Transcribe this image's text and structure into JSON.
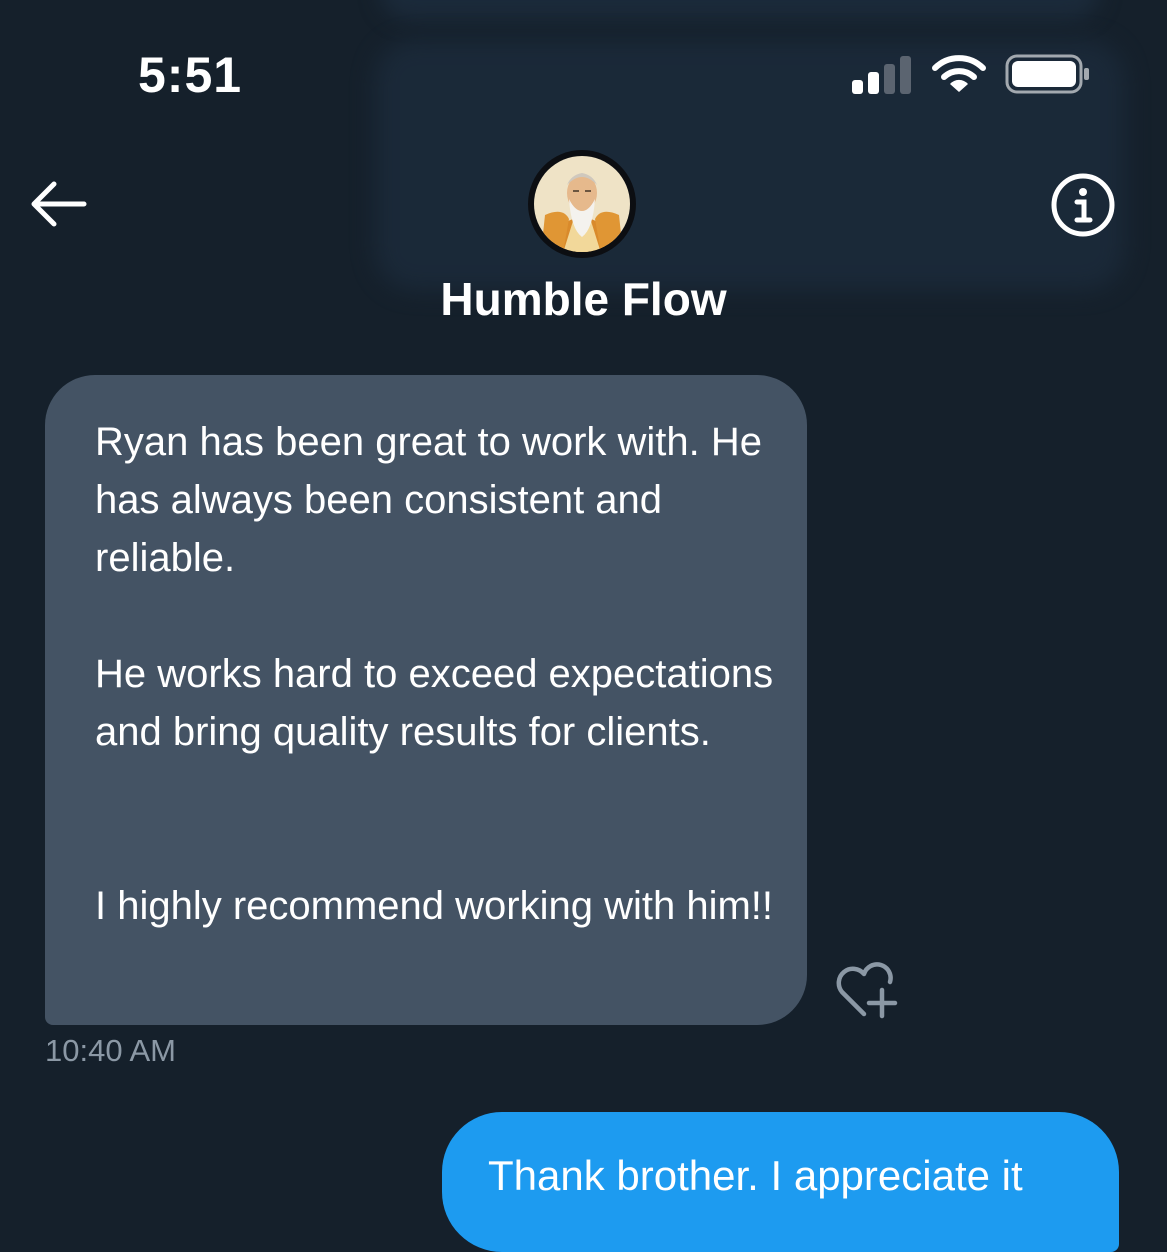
{
  "status_bar": {
    "time": "5:51",
    "signal_icon": "signal-bars-icon",
    "wifi_icon": "wifi-icon",
    "battery_icon": "battery-full-icon"
  },
  "header": {
    "back_icon": "back-arrow-icon",
    "info_icon": "info-icon",
    "contact_name": "Humble Flow",
    "avatar": "contact-avatar"
  },
  "messages": [
    {
      "direction": "incoming",
      "paragraphs": [
        "Ryan has been great to work with. He has always been consistent and reliable.",
        "He works hard to exceed expectations and bring quality results for clients.",
        "I highly recommend working with him!!"
      ],
      "time": "10:40 AM",
      "reaction_icon": "heart-plus-icon"
    },
    {
      "direction": "outgoing",
      "text": "Thank brother. I appreciate it"
    }
  ],
  "colors": {
    "background": "#15202b",
    "incoming_bubble": "#445364",
    "outgoing_bubble": "#1d9bf0",
    "timestamp": "#8b98a5",
    "text": "#ffffff"
  }
}
